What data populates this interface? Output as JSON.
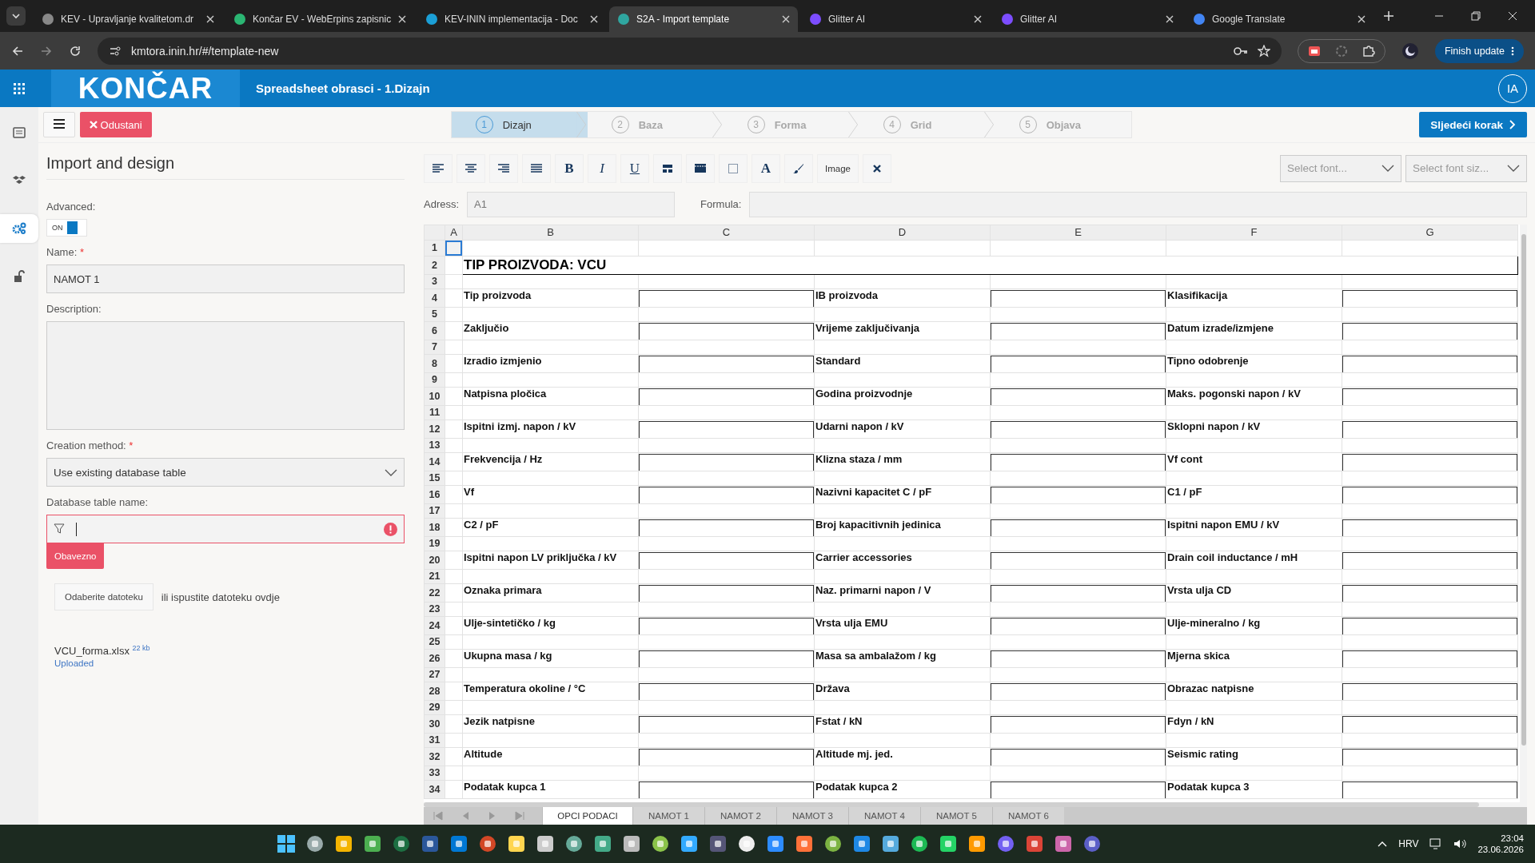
{
  "browser": {
    "tabs": [
      {
        "title": "KEV - Upravljanje kvalitetom.dr",
        "selected": false
      },
      {
        "title": "Končar EV - WebErpins zapisnic",
        "selected": false
      },
      {
        "title": "KEV-ININ implementacija - Doc",
        "selected": false
      },
      {
        "title": "S2A - Import template",
        "selected": true
      },
      {
        "title": "Glitter AI",
        "selected": false
      },
      {
        "title": "Glitter AI",
        "selected": false
      },
      {
        "title": "Google Translate",
        "selected": false
      }
    ],
    "url": "kmtora.inin.hr/#/template-new",
    "update_button": "Finish update"
  },
  "app": {
    "logo": "KONČAR",
    "title": "Spreadsheet obrasci - 1.Dizajn",
    "avatar": "IA"
  },
  "sidebar": {
    "items": [
      {
        "kind": "list",
        "selected": false
      },
      {
        "kind": "boxes",
        "selected": false
      },
      {
        "kind": "gears",
        "selected": true
      },
      {
        "kind": "lock",
        "selected": false
      }
    ]
  },
  "toolbar": {
    "cancel": "Odustani",
    "steps": [
      {
        "number": "1",
        "label": "Dizajn",
        "selected": true
      },
      {
        "number": "2",
        "label": "Baza",
        "selected": false
      },
      {
        "number": "3",
        "label": "Forma",
        "selected": false
      },
      {
        "number": "4",
        "label": "Grid",
        "selected": false
      },
      {
        "number": "5",
        "label": "Objava",
        "selected": false
      }
    ],
    "next": "Sljedeći korak"
  },
  "panel": {
    "heading": "Import and design",
    "advanced_label": "Advanced:",
    "toggle": {
      "label": "ON",
      "on": true
    },
    "name_label": "Name:",
    "name_required": "*",
    "name_value": "NAMOT 1",
    "description_label": "Description:",
    "method_label": "Creation method:",
    "method_required": "*",
    "method_value": "Use existing database table",
    "table_label": "Database table name:",
    "table_error": "Obavezno",
    "file_button": "Odaberite datoteku",
    "drop_text": "ili ispustite datoteku ovdje",
    "file": {
      "name": "VCU_forma.xlsx",
      "size": "22 kb",
      "status": "Uploaded"
    }
  },
  "editor": {
    "buttons": [
      {
        "kind": "align-left"
      },
      {
        "kind": "align-center"
      },
      {
        "kind": "align-right"
      },
      {
        "kind": "justify"
      },
      {
        "kind": "bold",
        "label": "B"
      },
      {
        "kind": "italic",
        "label": "I"
      },
      {
        "kind": "underline",
        "label": "U"
      },
      {
        "kind": "merge"
      },
      {
        "kind": "film"
      },
      {
        "kind": "border"
      },
      {
        "kind": "letter",
        "label": "A"
      },
      {
        "kind": "brush"
      },
      {
        "kind": "word",
        "label": "Image"
      },
      {
        "kind": "close"
      }
    ],
    "font_placeholder": "Select font...",
    "size_placeholder": "Select font siz...",
    "address_label": "Adress:",
    "address_placeholder": "A1",
    "formula_label": "Formula:"
  },
  "sheet": {
    "columns": [
      "A",
      "B",
      "C",
      "D",
      "E",
      "F",
      "G"
    ],
    "rows": [
      {
        "number": "1",
        "kind": "blank",
        "selected": true
      },
      {
        "number": "2",
        "kind": "title",
        "text": "TIP PROIZVODA: VCU",
        "selected": false
      },
      {
        "number": "3",
        "kind": "blank",
        "selected": false
      },
      {
        "number": "4",
        "kind": "fields",
        "labels": [
          "Tip proizvoda",
          "IB proizvoda",
          "Klasifikacija"
        ],
        "selected": false
      },
      {
        "number": "5",
        "kind": "blank",
        "selected": false
      },
      {
        "number": "6",
        "kind": "fields",
        "labels": [
          "Zaključio",
          "Vrijeme zaključivanja",
          "Datum izrade/izmjene"
        ],
        "selected": false
      },
      {
        "number": "7",
        "kind": "blank",
        "selected": false
      },
      {
        "number": "8",
        "kind": "fields",
        "labels": [
          "Izradio izmjenio",
          "Standard",
          "Tipno odobrenje"
        ],
        "selected": false
      },
      {
        "number": "9",
        "kind": "blank",
        "selected": false
      },
      {
        "number": "10",
        "kind": "fields",
        "labels": [
          "Natpisna pločica",
          "Godina proizvodnje",
          "Maks. pogonski napon / kV"
        ],
        "selected": false
      },
      {
        "number": "11",
        "kind": "blank",
        "selected": false
      },
      {
        "number": "12",
        "kind": "fields",
        "labels": [
          "Ispitni izmj. napon / kV",
          "Udarni napon / kV",
          "Sklopni napon / kV"
        ],
        "selected": false
      },
      {
        "number": "13",
        "kind": "blank",
        "selected": false
      },
      {
        "number": "14",
        "kind": "fields",
        "labels": [
          "Frekvencija / Hz",
          "Klizna staza / mm",
          "Vf cont"
        ],
        "selected": false
      },
      {
        "number": "15",
        "kind": "blank",
        "selected": false
      },
      {
        "number": "16",
        "kind": "fields",
        "labels": [
          "Vf",
          "Nazivni kapacitet C / pF",
          "C1 / pF"
        ],
        "selected": false
      },
      {
        "number": "17",
        "kind": "blank",
        "selected": false
      },
      {
        "number": "18",
        "kind": "fields",
        "labels": [
          "C2 / pF",
          "Broj kapacitivnih jedinica",
          "Ispitni napon EMU / kV"
        ],
        "selected": false
      },
      {
        "number": "19",
        "kind": "blank",
        "selected": false
      },
      {
        "number": "20",
        "kind": "fields",
        "labels": [
          "Ispitni napon LV priključka / kV",
          "Carrier accessories",
          "Drain coil inductance / mH"
        ],
        "selected": false
      },
      {
        "number": "21",
        "kind": "blank",
        "selected": false
      },
      {
        "number": "22",
        "kind": "fields",
        "labels": [
          "Oznaka primara",
          "Naz. primarni napon / V",
          "Vrsta ulja CD"
        ],
        "selected": false
      },
      {
        "number": "23",
        "kind": "blank",
        "selected": false
      },
      {
        "number": "24",
        "kind": "fields",
        "labels": [
          "Ulje-sintetičko / kg",
          "Vrsta ulja EMU",
          "Ulje-mineralno / kg"
        ],
        "selected": false
      },
      {
        "number": "25",
        "kind": "blank",
        "selected": false
      },
      {
        "number": "26",
        "kind": "fields",
        "labels": [
          "Ukupna masa / kg",
          "Masa sa ambalažom / kg",
          "Mjerna skica"
        ],
        "selected": false
      },
      {
        "number": "27",
        "kind": "blank",
        "selected": false
      },
      {
        "number": "28",
        "kind": "fields",
        "labels": [
          "Temperatura okoline / °C",
          "Država",
          "Obrazac natpisne"
        ],
        "selected": false
      },
      {
        "number": "29",
        "kind": "blank",
        "selected": false
      },
      {
        "number": "30",
        "kind": "fields",
        "labels": [
          "Jezik natpisne",
          "Fstat / kN",
          "Fdyn / kN"
        ],
        "selected": false
      },
      {
        "number": "31",
        "kind": "blank",
        "selected": false
      },
      {
        "number": "32",
        "kind": "fields",
        "labels": [
          "Altitude",
          "Altitude mj. jed.",
          "Seismic rating"
        ],
        "selected": false
      },
      {
        "number": "33",
        "kind": "blank",
        "selected": false
      },
      {
        "number": "34",
        "kind": "fields",
        "labels": [
          "Podatak kupca 1",
          "Podatak kupca 2",
          "Podatak kupca 3"
        ],
        "selected": false
      }
    ],
    "tabs": [
      {
        "label": "OPCI PODACI",
        "selected": true
      },
      {
        "label": "NAMOT 1",
        "selected": false
      },
      {
        "label": "NAMOT 2",
        "selected": false
      },
      {
        "label": "NAMOT 3",
        "selected": false
      },
      {
        "label": "NAMOT 4",
        "selected": false
      },
      {
        "label": "NAMOT 5",
        "selected": false
      },
      {
        "label": "NAMOT 6",
        "selected": false
      }
    ]
  },
  "taskbar": {
    "language": "HRV",
    "time": "23:04",
    "date": "23.06.2026"
  }
}
